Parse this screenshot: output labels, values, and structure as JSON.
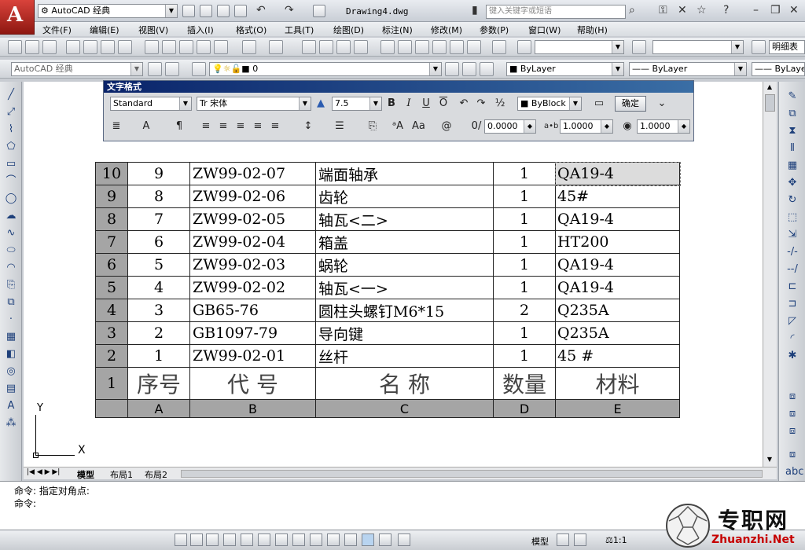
{
  "titlebar": {
    "workspace": "AutoCAD 经典",
    "document_title": "Drawing4.dwg",
    "search_placeholder": "键入关键字或短语"
  },
  "menu": [
    "文件(F)",
    "编辑(E)",
    "视图(V)",
    "插入(I)",
    "格式(O)",
    "工具(T)",
    "绘图(D)",
    "标注(N)",
    "修改(M)",
    "参数(P)",
    "窗口(W)",
    "帮助(H)"
  ],
  "toolbar3": {
    "workspace": "AutoCAD 经典",
    "layer": "0",
    "color": "ByLayer",
    "linetype": "ByLayer",
    "lineweight": "ByLayer",
    "text_style_right": "明细表"
  },
  "text_format": {
    "title": "文字格式",
    "style": "Standard",
    "font": "宋体",
    "font_prefix": "Tr",
    "height": "7.5",
    "bold": "B",
    "italic": "I",
    "underline": "U",
    "overline": "O",
    "color": "ByBlock",
    "ok": "确定",
    "oblique": "0.0000",
    "tracking": "1.0000",
    "width_factor": "1.0000"
  },
  "table": {
    "rows": [
      {
        "row": "10",
        "a": "9",
        "b": "ZW99-02-07",
        "c": "端面轴承",
        "d": "1",
        "e": "QA19-4"
      },
      {
        "row": "9",
        "a": "8",
        "b": "ZW99-02-06",
        "c": "齿轮",
        "d": "1",
        "e": "45#"
      },
      {
        "row": "8",
        "a": "7",
        "b": "ZW99-02-05",
        "c": "轴瓦<二>",
        "d": "1",
        "e": "QA19-4"
      },
      {
        "row": "7",
        "a": "6",
        "b": "ZW99-02-04",
        "c": "箱盖",
        "d": "1",
        "e": "HT200"
      },
      {
        "row": "6",
        "a": "5",
        "b": "ZW99-02-03",
        "c": "蜗轮",
        "d": "1",
        "e": "QA19-4"
      },
      {
        "row": "5",
        "a": "4",
        "b": "ZW99-02-02",
        "c": "轴瓦<一>",
        "d": "1",
        "e": "QA19-4"
      },
      {
        "row": "4",
        "a": "3",
        "b": "GB65-76",
        "c": "圆柱头螺钉M6*15",
        "d": "2",
        "e": "Q235A"
      },
      {
        "row": "3",
        "a": "2",
        "b": "GB1097-79",
        "c": "导向键",
        "d": "1",
        "e": "Q235A"
      },
      {
        "row": "2",
        "a": "1",
        "b": "ZW99-02-01",
        "c": "丝杆",
        "d": "1",
        "e": "45 #"
      }
    ],
    "header": {
      "row": "1",
      "a": "序号",
      "b": "代 号",
      "c": "名 称",
      "d": "数量",
      "e": "材料"
    },
    "columns": [
      "A",
      "B",
      "C",
      "D",
      "E"
    ]
  },
  "ucs": {
    "y": "Y",
    "x": "X"
  },
  "tabs": [
    "模型",
    "布局1",
    "布局2"
  ],
  "command": [
    "命令: 指定对角点:",
    "命令:"
  ],
  "status": {
    "model": "模型",
    "scale": "1:1"
  },
  "watermark": {
    "cn": "专职网",
    "en": "Zhuanzhi.Net"
  }
}
